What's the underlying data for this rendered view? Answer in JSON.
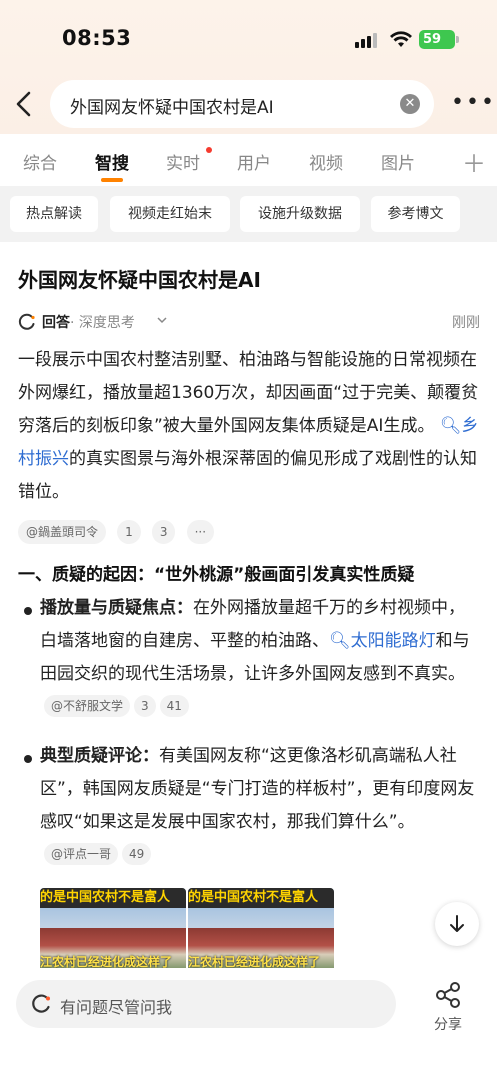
{
  "status": {
    "time": "08:53",
    "battery": "59"
  },
  "search": {
    "query": "外国网友怀疑中国农村是AI"
  },
  "tabs": [
    {
      "label": "综合"
    },
    {
      "label": "智搜"
    },
    {
      "label": "实时"
    },
    {
      "label": "用户"
    },
    {
      "label": "视频"
    },
    {
      "label": "图片"
    }
  ],
  "chips": [
    "热点解读",
    "视频走红始末",
    "设施升级数据",
    "参考博文"
  ],
  "result": {
    "title": "外国网友怀疑中国农村是AI",
    "answer_label": "回答",
    "answer_mode": "· 深度思考",
    "answer_time": "刚刚",
    "intro_a": "一段展示中国农村整洁别墅、柏油路与智能设施的日常视频在外网爆红，播放量超1360万次，却因画面“过于完美、颠覆贫穷落后的刻板印象”被大量外国网友集体质疑是AI生成。",
    "intro_link": "乡村振兴",
    "intro_b": "的真实图景与海外根深蒂固的偏见形成了戏剧性的认知错位。",
    "intro_cites": [
      "@鍋盖頭司令",
      "1",
      "3",
      "···"
    ],
    "section1_title": "一、质疑的起因：“世外桃源”般画面引发真实性质疑",
    "b1_head": "播放量与质疑焦点：",
    "b1_text_a": "在外网播放量超千万的乡村视频中，白墙落地窗的自建房、平整的柏油路、",
    "b1_link": "太阳能路灯",
    "b1_text_b": "和与田园交织的现代生活场景，让许多外国网友感到不真实。",
    "b1_cites": [
      "@不舒服文学",
      "3",
      "41"
    ],
    "b2_head": "典型质疑评论：",
    "b2_text": "有美国网友称“这更像洛杉矶高端私人社区”，韩国网友质疑是“专门打造的样板村”，更有印度网友感叹“如果这是发展中国家农村，那我们算什么”。",
    "b2_cites": [
      "@评点一哥",
      "49"
    ],
    "thumb_banner": "的是中国农村不是富人",
    "thumb_caption": "江农村已经进化成这样了"
  },
  "bottom": {
    "ask_placeholder": "有问题尽管问我",
    "share_label": "分享"
  }
}
